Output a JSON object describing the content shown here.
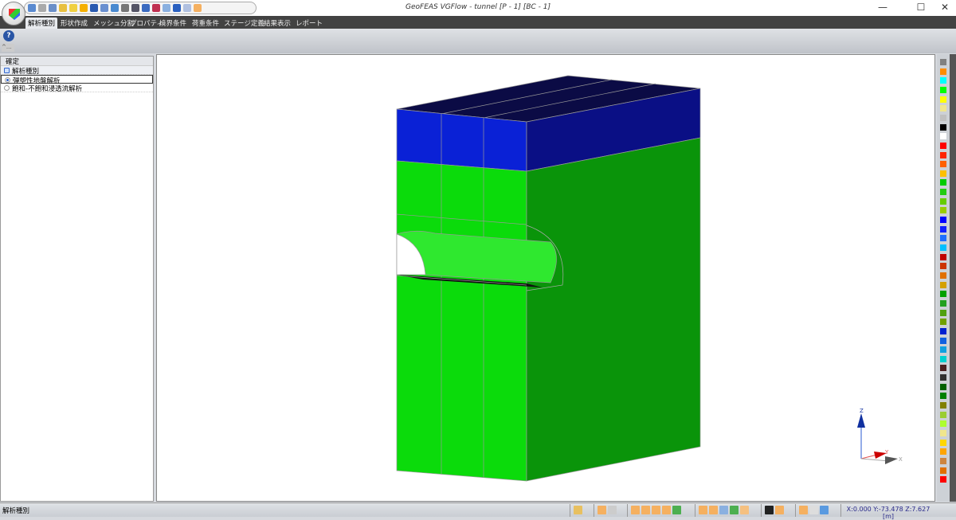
{
  "window": {
    "title": "GeoFEAS VGFlow - tunnel [P - 1] [BC - 1]",
    "minimize": "—",
    "maximize": "☐",
    "close": "✕"
  },
  "menu": {
    "tabs": [
      "解析種別",
      "形状作成",
      "メッシュ分割",
      "プロパティ",
      "境界条件",
      "荷重条件",
      "ステージ定義",
      "結果表示",
      "レポート"
    ],
    "active": 0
  },
  "ribbon": {
    "help_icon": "?",
    "collapse_label": "^..."
  },
  "panel": {
    "header": "確定",
    "category": "解析種別",
    "options": [
      {
        "label": "弾塑性地盤解析",
        "selected": true
      },
      {
        "label": "飽和-不飽和浸透流解析",
        "selected": false
      }
    ]
  },
  "model": {
    "top_color": "#0b0b45",
    "band_front": "#0a21d6",
    "band_side": "#0a0f85",
    "soil_front": "#0bdb0b",
    "soil_side": "#0a940a",
    "mesh_line": "#9a9a9a"
  },
  "axes": {
    "z": "Z",
    "y": "Y",
    "x": "X"
  },
  "palette": [
    "#808080",
    "#ff8c00",
    "#00ffff",
    "#00ff00",
    "#ffff00",
    "#f0e68c",
    "#c0c0c0",
    "#000000",
    "#ffffff",
    "#ff0000",
    "#ff2400",
    "#ff6000",
    "#ffc000",
    "#00cc00",
    "#22cc11",
    "#66cc00",
    "#99cc00",
    "#0000ff",
    "#1020ff",
    "#1e6fff",
    "#00bfff",
    "#c00000",
    "#cc3300",
    "#e07000",
    "#d4a000",
    "#00a000",
    "#22a020",
    "#50a010",
    "#70a000",
    "#0020d0",
    "#1060e0",
    "#10a0e0",
    "#00d0d0",
    "#4a2020",
    "#303030",
    "#006000",
    "#008000",
    "#808000",
    "#9acd32",
    "#adff2f",
    "#f0e68c",
    "#ffd700",
    "#ffa500",
    "#cd853f",
    "#e07000",
    "#ff0000"
  ],
  "status": {
    "left": "解析種別",
    "coords": "X:0.000 Y:-73.478 Z:7.627 [m]"
  }
}
